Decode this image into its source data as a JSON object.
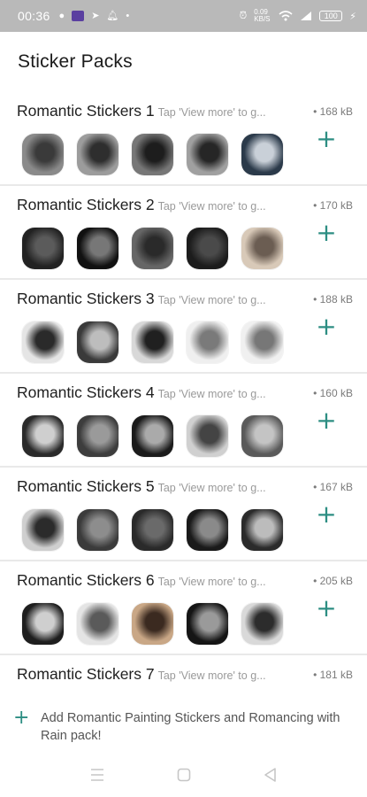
{
  "status_bar": {
    "time": "00:36",
    "network_speed": "0.09 KB/S",
    "battery": "100",
    "icons": [
      "messenger-icon",
      "app-icon",
      "telegram-icon",
      "notification-bell-icon",
      "dot-icon",
      "alarm-icon",
      "wifi-icon",
      "signal-icon",
      "battery-icon",
      "charging-icon"
    ]
  },
  "header": {
    "title": "Sticker Packs"
  },
  "packs": [
    {
      "name": "Romantic Stickers 1",
      "desc": "Tap 'View more' to g...",
      "size": "• 168 kB",
      "tones": [
        [
          "#8a8a8a",
          "#3a3a3a"
        ],
        [
          "#9c9c9c",
          "#2e2e2e"
        ],
        [
          "#777",
          "#1d1d1d"
        ],
        [
          "#a0a0a0",
          "#262626"
        ],
        [
          "#2b3a4a",
          "#c9d0d8"
        ]
      ]
    },
    {
      "name": "Romantic Stickers 2",
      "desc": "Tap 'View more' to g...",
      "size": "• 170 kB",
      "tones": [
        [
          "#222",
          "#5b5b5b"
        ],
        [
          "#111",
          "#777"
        ],
        [
          "#666",
          "#2a2a2a"
        ],
        [
          "#1c1c1c",
          "#4a4a4a"
        ],
        [
          "#d8c9b8",
          "#6b5d52"
        ]
      ]
    },
    {
      "name": "Romantic Stickers 3",
      "desc": "Tap 'View more' to g...",
      "size": "• 188 kB",
      "tones": [
        [
          "#e5e5e5",
          "#2a2a2a"
        ],
        [
          "#3a3a3a",
          "#bdbdbd"
        ],
        [
          "#d8d8d8",
          "#202020"
        ],
        [
          "#efefef",
          "#7a7a7a"
        ],
        [
          "#f0f0f0",
          "#777"
        ]
      ]
    },
    {
      "name": "Romantic Stickers 4",
      "desc": "Tap 'View more' to g...",
      "size": "• 160 kB",
      "tones": [
        [
          "#2a2a2a",
          "#cfcfcf"
        ],
        [
          "#3d3d3d",
          "#9a9a9a"
        ],
        [
          "#1b1b1b",
          "#aaaaaa"
        ],
        [
          "#d0d0d0",
          "#444"
        ],
        [
          "#5a5a5a",
          "#c4c4c4"
        ]
      ]
    },
    {
      "name": "Romantic Stickers 5",
      "desc": "Tap 'View more' to g...",
      "size": "• 167 kB",
      "tones": [
        [
          "#cfcfcf",
          "#2b2b2b"
        ],
        [
          "#3b3b3b",
          "#8d8d8d"
        ],
        [
          "#2a2a2a",
          "#6a6a6a"
        ],
        [
          "#1a1a1a",
          "#8a8a8a"
        ],
        [
          "#2b2b2b",
          "#bcbcbc"
        ]
      ]
    },
    {
      "name": "Romantic Stickers 6",
      "desc": "Tap 'View more' to g...",
      "size": "• 205 kB",
      "tones": [
        [
          "#1e1e1e",
          "#cfcfcf"
        ],
        [
          "#e4e4e4",
          "#5a5a5a"
        ],
        [
          "#c9a786",
          "#3b2a20"
        ],
        [
          "#151515",
          "#9a9a9a"
        ],
        [
          "#d9d9d9",
          "#2c2c2c"
        ]
      ]
    },
    {
      "name": "Romantic Stickers 7",
      "desc": "Tap 'View more' to g...",
      "size": "• 181 kB",
      "tones": []
    }
  ],
  "footer": {
    "add_text": "Add Romantic Painting Stickers and Romancing with Rain pack!"
  },
  "nav": {
    "menu_icon": "menu-icon",
    "home_icon": "home-icon",
    "back_icon": "back-icon"
  },
  "colors": {
    "accent": "#2d8e83",
    "status_bar_bg": "#b9b9b9",
    "divider": "#e9e9e9"
  }
}
